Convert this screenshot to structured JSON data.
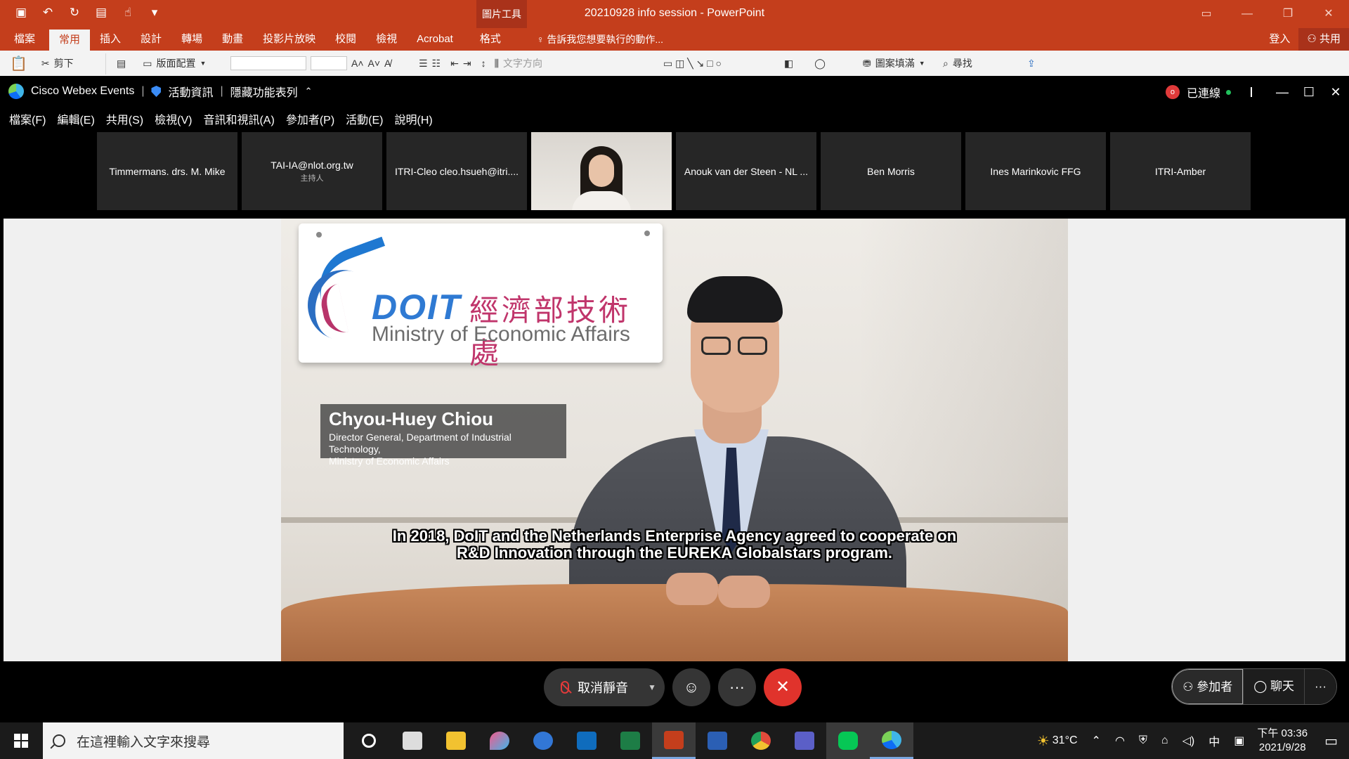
{
  "powerpoint": {
    "doc_title": "20210928 info session - PowerPoint",
    "context_tool": "圖片工具",
    "tabs": [
      "檔案",
      "常用",
      "插入",
      "設計",
      "轉場",
      "動畫",
      "投影片放映",
      "校閱",
      "檢視",
      "Acrobat",
      "格式"
    ],
    "active_tab": "常用",
    "tell_me": "告訴我您想要執行的動作...",
    "sign_in": "登入",
    "share": "共用",
    "ribbon": {
      "cut": "剪下",
      "layout": "版面配置",
      "text_direction": "文字方向",
      "shape_fill": "圖案填滿",
      "find": "尋找"
    }
  },
  "webex": {
    "app_name": "Cisco Webex Events",
    "event_info": "活動資訊",
    "hide_menu": "隱藏功能表列",
    "record_count": "o",
    "connection": "已連線",
    "menu": [
      "檔案(F)",
      "編輯(E)",
      "共用(S)",
      "檢視(V)",
      "音訊和視訊(A)",
      "參加者(P)",
      "活動(E)",
      "說明(H)"
    ],
    "thumbnails": [
      {
        "name": "Timmermans. drs. M. Mike",
        "sub": ""
      },
      {
        "name": "TAI-IA@nlot.org.tw",
        "sub": "主持人"
      },
      {
        "name": "ITRI-Cleo cleo.hsueh@itri....",
        "sub": ""
      },
      {
        "name": "",
        "sub": ""
      },
      {
        "name": "Anouk van der Steen - NL ...",
        "sub": ""
      },
      {
        "name": "Ben Morris",
        "sub": ""
      },
      {
        "name": "Ines Marinkovic FFG",
        "sub": ""
      },
      {
        "name": "ITRI-Amber",
        "sub": ""
      }
    ],
    "video": {
      "sign_logo_text": "DOIT",
      "sign_zh": "經濟部技術處",
      "sign_en": "Ministry of Economic Affairs",
      "speaker_name": "Chyou-Huey Chiou",
      "speaker_title_1": "Director General, Department of Industrial Technology,",
      "speaker_title_2": "Ministry of Economic Affairs",
      "subtitle_1": "In 2018, DoIT and the Netherlands Enterprise Agency agreed to cooperate on",
      "subtitle_2": "R&D Innovation through the EUREKA Globalstars program."
    },
    "controls": {
      "unmute": "取消靜音",
      "participants": "參加者",
      "chat": "聊天"
    }
  },
  "taskbar": {
    "search_placeholder": "在這裡輸入文字來搜尋",
    "temperature": "31°C",
    "ime": "中",
    "time": "下午 03:36",
    "date": "2021/9/28"
  },
  "colors": {
    "ppt_accent": "#c43e1c",
    "end_call": "#e0332c",
    "connected_dot": "#21c15c"
  }
}
